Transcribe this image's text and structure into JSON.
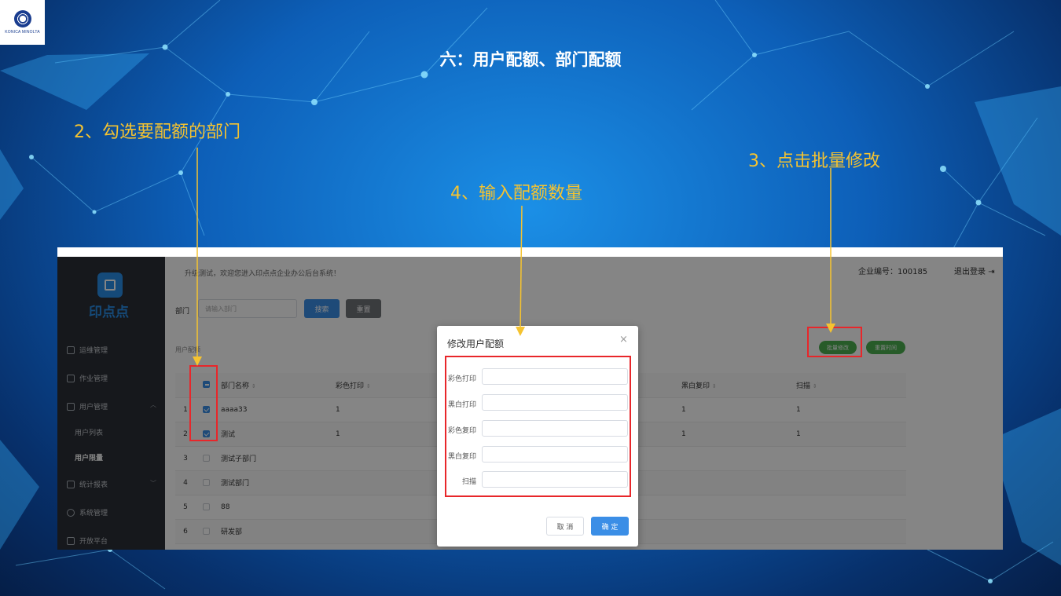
{
  "slide": {
    "title": "六：用户配额、部门配额",
    "logo_text": "KONICA MINOLTA"
  },
  "annotations": {
    "step2": "2、勾选要配额的部门",
    "step3": "3、点击批量修改",
    "step4": "4、输入配额数量"
  },
  "colors": {
    "annotation": "#f5c330",
    "highlight_box": "#e8262a",
    "primary_button": "#3b8ee6",
    "green_button": "#4caf50",
    "sidebar_bg": "#2b2f36"
  },
  "app": {
    "brand_name": "印点点",
    "welcome": "升级测试，欢迎您进入印点点企业办公后台系统！",
    "enterprise_id": "企业编号：100185",
    "logout": "退出登录",
    "sidebar": {
      "items": [
        {
          "label": "运维管理",
          "icon": "calendar-icon"
        },
        {
          "label": "作业管理",
          "icon": "document-icon"
        },
        {
          "label": "用户管理",
          "icon": "mail-icon"
        },
        {
          "label": "统计报表",
          "icon": "chart-icon"
        },
        {
          "label": "系统管理",
          "icon": "gear-icon"
        },
        {
          "label": "开放平台",
          "icon": "external-icon"
        }
      ],
      "sub_items": [
        {
          "label": "用户列表"
        },
        {
          "label": "用户限量"
        }
      ]
    },
    "filter": {
      "label": "部门",
      "placeholder": "请输入部门",
      "search_button": "搜索",
      "reset_button": "重置"
    },
    "section_title": "用户配额",
    "batch_edit_button": "批量修改",
    "reset_time_button": "重置时间",
    "table": {
      "columns": [
        "部门名称",
        "彩色打印",
        "黑白复印",
        "扫描"
      ],
      "rows": [
        {
          "idx": "1",
          "checked": true,
          "name": "aaaa33",
          "color_print": "1",
          "bw_copy": "1",
          "scan": "1"
        },
        {
          "idx": "2",
          "checked": true,
          "name": "测试",
          "color_print": "1",
          "bw_copy": "1",
          "scan": "1"
        },
        {
          "idx": "3",
          "checked": false,
          "name": "测试子部门",
          "color_print": "",
          "bw_copy": "",
          "scan": ""
        },
        {
          "idx": "4",
          "checked": false,
          "name": "测试部门",
          "color_print": "",
          "bw_copy": "",
          "scan": ""
        },
        {
          "idx": "5",
          "checked": false,
          "name": "88",
          "color_print": "",
          "bw_copy": "",
          "scan": ""
        },
        {
          "idx": "6",
          "checked": false,
          "name": "研发部",
          "color_print": "",
          "bw_copy": "",
          "scan": ""
        }
      ]
    },
    "modal": {
      "title": "修改用户配额",
      "close": "×",
      "fields": [
        {
          "label": "彩色打印",
          "value": ""
        },
        {
          "label": "黑白打印",
          "value": ""
        },
        {
          "label": "彩色复印",
          "value": ""
        },
        {
          "label": "黑白复印",
          "value": ""
        },
        {
          "label": "扫描",
          "value": ""
        }
      ],
      "cancel": "取 消",
      "confirm": "确 定"
    }
  }
}
